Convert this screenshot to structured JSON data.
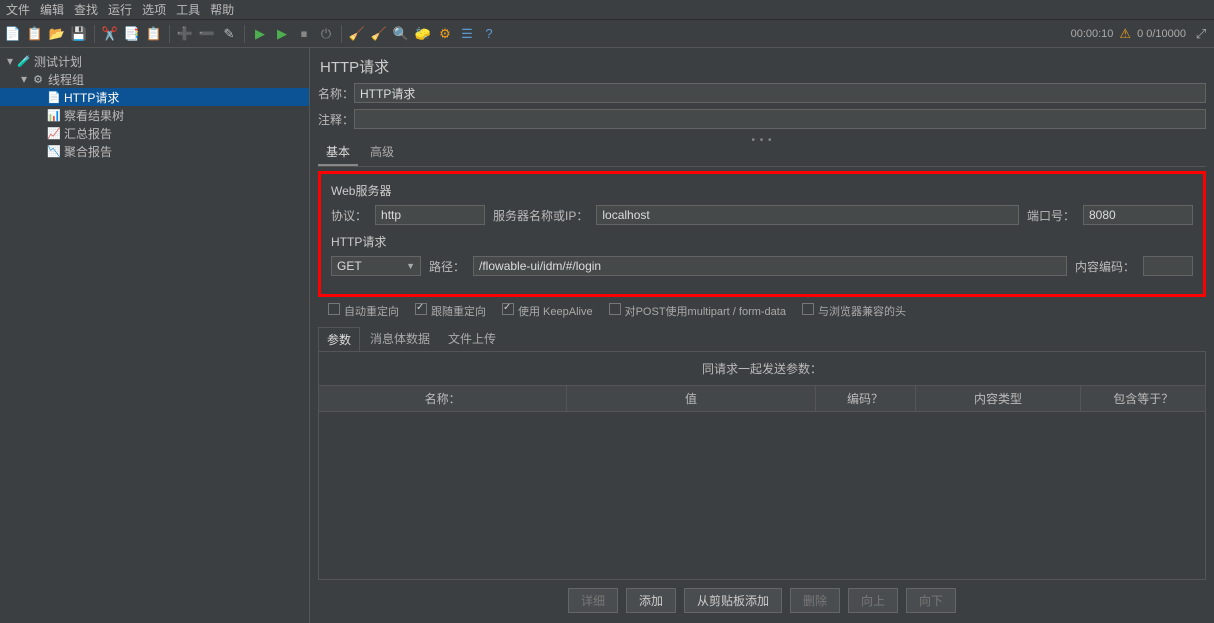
{
  "menu": {
    "file": "文件",
    "edit": "编辑",
    "search": "查找",
    "run": "运行",
    "options": "选项",
    "tools": "工具",
    "help": "帮助"
  },
  "status": {
    "time": "00:00:10",
    "counts": "0  0/10000"
  },
  "tree": {
    "plan": "测试计划",
    "threadGroup": "线程组",
    "httpReq": "HTTP请求",
    "viewResults": "察看结果树",
    "summaryReport": "汇总报告",
    "aggregateReport": "聚合报告"
  },
  "panel": {
    "title": "HTTP请求",
    "nameLabel": "名称：",
    "nameValue": "HTTP请求",
    "commentLabel": "注释：",
    "commentValue": ""
  },
  "subtabs": {
    "basic": "基本",
    "advanced": "高级"
  },
  "webserver": {
    "groupLabel": "Web服务器",
    "protocolLabel": "协议：",
    "protocolValue": "http",
    "serverLabel": "服务器名称或IP：",
    "serverValue": "localhost",
    "portLabel": "端口号：",
    "portValue": "8080"
  },
  "httpreq": {
    "groupLabel": "HTTP请求",
    "method": "GET",
    "pathLabel": "路径：",
    "pathValue": "/flowable-ui/idm/#/login",
    "encodingLabel": "内容编码：",
    "encodingValue": ""
  },
  "checks": {
    "autoRedirect": "自动重定向",
    "followRedirect": "跟随重定向",
    "keepalive": "使用 KeepAlive",
    "multipart": "对POST使用multipart / form-data",
    "browserHeaders": "与浏览器兼容的头"
  },
  "paramtabs": {
    "params": "参数",
    "body": "消息体数据",
    "upload": "文件上传"
  },
  "paramsPanel": {
    "title": "同请求一起发送参数：",
    "colName": "名称：",
    "colValue": "值",
    "colEncode": "编码？",
    "colContentType": "内容类型",
    "colInclude": "包含等于？"
  },
  "bottomButtons": {
    "detail": "详细",
    "add": "添加",
    "clipboard": "从剪贴板添加",
    "delete": "删除",
    "up": "向上",
    "down": "向下"
  }
}
